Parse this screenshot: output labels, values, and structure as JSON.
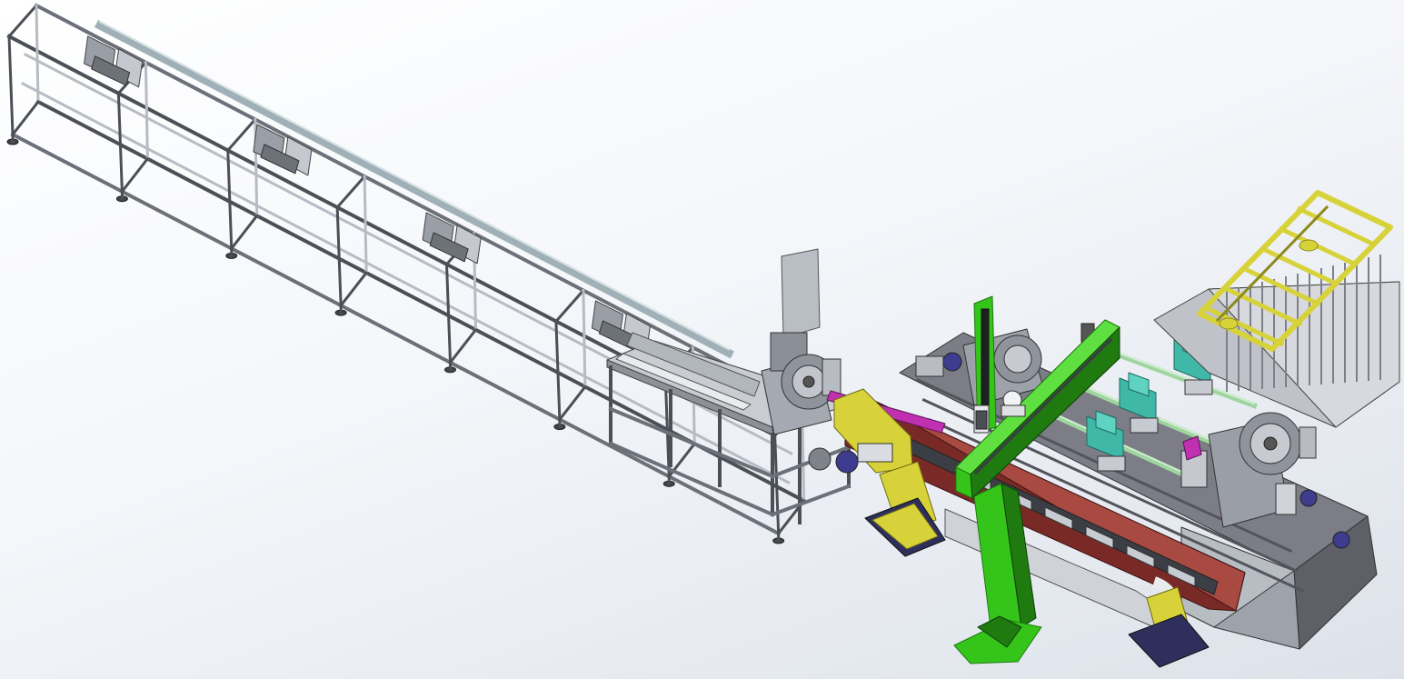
{
  "viewport": {
    "background_top": "#ffffff",
    "background_bottom": "#dde2ea"
  },
  "model": {
    "colors": {
      "frame_light": "#b7bcc4",
      "frame_dark": "#4b4f56",
      "rail": "#9fb1b6",
      "base_top": "#7c7d86",
      "base_side": "#5e5f67",
      "gantry_green": "#35c41a",
      "gantry_green_dark": "#1f7a10",
      "yellow_part": "#d8d23a",
      "yellow_dark": "#8c8a1c",
      "teal_part": "#3fb8a8",
      "magenta_part": "#c030b0",
      "motor_blue": "#3d3c8e",
      "rod_green": "#9fd6a0",
      "red_beam": "#7a2a26",
      "chuck_grey": "#8f939b"
    },
    "components": [
      "feed-rack-frame",
      "loading-station",
      "chuck-headstock",
      "yellow-gripper-arm",
      "machine-base",
      "linear-guide-rail",
      "gantry-column",
      "gantry-crossbeam",
      "vertical-z-axis",
      "tailstock-chuck",
      "guide-rods",
      "tool-magazine"
    ]
  }
}
